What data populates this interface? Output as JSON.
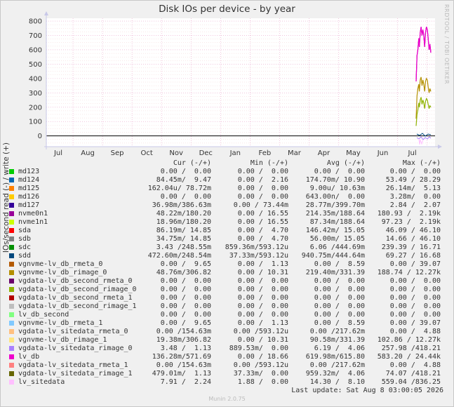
{
  "chart_data": {
    "type": "line",
    "title": "Disk IOs per device - by year",
    "ylabel": "IOs/second read (-) / write (+)",
    "ylim": [
      -75,
      820
    ],
    "yticks": [
      0,
      100,
      200,
      300,
      400,
      500,
      600,
      700,
      800
    ],
    "xticks": [
      "Jul",
      "Aug",
      "Sep",
      "Oct",
      "Nov",
      "Dec",
      "Jan",
      "Feb",
      "Mar",
      "Apr",
      "May",
      "Jun",
      "Jul"
    ],
    "grid": true,
    "series": [
      {
        "name": "md123",
        "color": "#00cc00",
        "cur": "0.00 /  0.00",
        "min": "0.00 /  0.00",
        "avg": "0.00 /  0.00",
        "max": "0.00 /  0.00"
      },
      {
        "name": "md124",
        "color": "#0066b3",
        "cur": "84.45m/  9.47",
        "min": "0.00 /  2.16",
        "avg": "174.70m/ 10.90",
        "max": "53.49 / 28.29"
      },
      {
        "name": "md125",
        "color": "#ff8000",
        "cur": "162.04u/ 78.72m",
        "min": "0.00 /  0.00",
        "avg": "9.00u/ 10.63m",
        "max": "26.14m/  5.13"
      },
      {
        "name": "md126",
        "color": "#ffcc00",
        "cur": "0.00 /  0.00",
        "min": "0.00 /  0.00",
        "avg": "643.00n/  0.00",
        "max": "3.28m/  0.00"
      },
      {
        "name": "md127",
        "color": "#330099",
        "cur": "36.98m/386.63m",
        "min": "0.00 / 73.44m",
        "avg": "28.77m/399.70m",
        "max": "2.84 /  2.07"
      },
      {
        "name": "nvme0n1",
        "color": "#990099",
        "cur": "48.22m/180.20",
        "min": "0.00 / 16.55",
        "avg": "214.35m/188.64",
        "max": "180.93 /  2.19k",
        "line": [
          [
            0,
            380
          ],
          [
            0.06,
            560
          ],
          [
            0.12,
            600
          ],
          [
            0.18,
            680
          ],
          [
            0.22,
            620
          ],
          [
            0.28,
            720
          ],
          [
            0.34,
            760
          ],
          [
            0.4,
            700
          ],
          [
            0.46,
            740
          ],
          [
            0.52,
            700
          ],
          [
            0.58,
            620
          ],
          [
            0.64,
            720
          ],
          [
            0.7,
            760
          ],
          [
            0.76,
            740
          ],
          [
            0.82,
            680
          ],
          [
            0.88,
            600
          ],
          [
            0.94,
            640
          ],
          [
            1.0,
            580
          ]
        ]
      },
      {
        "name": "nvme1n1",
        "color": "#ccff00",
        "cur": "18.96m/180.20",
        "min": "0.00 / 16.55",
        "avg": "87.34m/188.64",
        "max": "97.23 /  2.19k"
      },
      {
        "name": "sda",
        "color": "#ff0000",
        "cur": "86.19m/ 14.85",
        "min": "0.00 /  4.70",
        "avg": "146.42m/ 15.05",
        "max": "46.09 / 46.10"
      },
      {
        "name": "sdb",
        "color": "#808080",
        "cur": "34.75m/ 14.85",
        "min": "0.00 /  4.70",
        "avg": "56.00m/ 15.05",
        "max": "14.66 / 46.10"
      },
      {
        "name": "sdc",
        "color": "#008f00",
        "cur": "3.43 /248.55m",
        "min": "859.36m/593.12u",
        "avg": "6.06 /444.69m",
        "max": "239.39 / 16.71"
      },
      {
        "name": "sdd",
        "color": "#00487d",
        "cur": "472.60m/248.54m",
        "min": "37.33m/593.12u",
        "avg": "940.75m/444.64m",
        "max": "69.27 / 16.68"
      },
      {
        "name": "vgnvme-lv_db_rmeta_0",
        "color": "#b35a00",
        "cur": "0.00 /  9.65",
        "min": "0.00 /  1.13",
        "avg": "0.00 /  8.59",
        "max": "0.00 / 39.07"
      },
      {
        "name": "vgnvme-lv_db_rimage_0",
        "color": "#b38f00",
        "cur": "48.76m/306.82",
        "min": "0.00 / 10.31",
        "avg": "219.40m/331.39",
        "max": "188.74 / 12.27k",
        "line": [
          [
            0,
            120
          ],
          [
            0.06,
            280
          ],
          [
            0.12,
            330
          ],
          [
            0.18,
            360
          ],
          [
            0.22,
            310
          ],
          [
            0.28,
            390
          ],
          [
            0.34,
            410
          ],
          [
            0.4,
            350
          ],
          [
            0.46,
            390
          ],
          [
            0.52,
            360
          ],
          [
            0.58,
            310
          ],
          [
            0.64,
            380
          ],
          [
            0.7,
            400
          ],
          [
            0.76,
            390
          ],
          [
            0.82,
            340
          ],
          [
            0.88,
            300
          ],
          [
            0.94,
            330
          ],
          [
            1.0,
            310
          ]
        ]
      },
      {
        "name": "vgdata-lv_db_second_rmeta_0",
        "color": "#6b006b",
        "cur": "0.00 /  0.00",
        "min": "0.00 /  0.00",
        "avg": "0.00 /  0.00",
        "max": "0.00 /  0.00"
      },
      {
        "name": "vgdata-lv_db_second_rimage_0",
        "color": "#8fb300",
        "cur": "0.00 /  0.00",
        "min": "0.00 /  0.00",
        "avg": "0.00 /  0.00",
        "max": "0.00 /  0.00",
        "line": [
          [
            0,
            70
          ],
          [
            0.06,
            150
          ],
          [
            0.12,
            180
          ],
          [
            0.18,
            230
          ],
          [
            0.22,
            200
          ],
          [
            0.28,
            250
          ],
          [
            0.34,
            270
          ],
          [
            0.4,
            220
          ],
          [
            0.46,
            250
          ],
          [
            0.52,
            230
          ],
          [
            0.58,
            190
          ],
          [
            0.64,
            240
          ],
          [
            0.7,
            260
          ],
          [
            0.76,
            250
          ],
          [
            0.82,
            220
          ],
          [
            0.88,
            190
          ],
          [
            0.94,
            210
          ],
          [
            1.0,
            200
          ]
        ]
      },
      {
        "name": "vgdata-lv_db_second_rmeta_1",
        "color": "#b30000",
        "cur": "0.00 /  0.00",
        "min": "0.00 /  0.00",
        "avg": "0.00 /  0.00",
        "max": "0.00 /  0.00"
      },
      {
        "name": "vgdata-lv_db_second_rimage_1",
        "color": "#bebebe",
        "cur": "0.00 /  0.00",
        "min": "0.00 /  0.00",
        "avg": "0.00 /  0.00",
        "max": "0.00 /  0.00"
      },
      {
        "name": "lv_db_second",
        "color": "#80ff80",
        "cur": "0.00 /  0.00",
        "min": "0.00 /  0.00",
        "avg": "0.00 /  0.00",
        "max": "0.00 /  0.00"
      },
      {
        "name": "vgnvme-lv_db_rmeta_1",
        "color": "#80c9ff",
        "cur": "0.00 /  9.65",
        "min": "0.00 /  1.13",
        "avg": "0.00 /  8.59",
        "max": "0.00 / 39.07"
      },
      {
        "name": "vgdata-lv_sitedata_rmeta_0",
        "color": "#ffc080",
        "cur": "0.00 /154.63m",
        "min": "0.00 /593.12u",
        "avg": "0.00 /217.62m",
        "max": "0.00 /  4.88"
      },
      {
        "name": "vgnvme-lv_db_rimage_1",
        "color": "#ffe680",
        "cur": "19.38m/306.82",
        "min": "0.00 / 10.31",
        "avg": "90.58m/331.39",
        "max": "102.86 / 12.27k"
      },
      {
        "name": "vgdata-lv_sitedata_rimage_0",
        "color": "#aa80ff",
        "cur": "3.48 /  1.13",
        "min": "889.53m/  0.00",
        "avg": "6.19 /  4.06",
        "max": "257.98 /418.21"
      },
      {
        "name": "lv_db",
        "color": "#ee00cc",
        "cur": "136.28m/571.69",
        "min": "0.00 / 18.66",
        "avg": "619.98m/615.80",
        "max": "583.20 / 24.44k",
        "line": [
          [
            0,
            380
          ],
          [
            0.06,
            560
          ],
          [
            0.12,
            600
          ],
          [
            0.18,
            680
          ],
          [
            0.22,
            620
          ],
          [
            0.28,
            720
          ],
          [
            0.34,
            760
          ],
          [
            0.4,
            700
          ],
          [
            0.46,
            740
          ],
          [
            0.52,
            700
          ],
          [
            0.58,
            620
          ],
          [
            0.64,
            720
          ],
          [
            0.7,
            760
          ],
          [
            0.76,
            740
          ],
          [
            0.82,
            680
          ],
          [
            0.88,
            600
          ],
          [
            0.94,
            640
          ],
          [
            1.0,
            580
          ]
        ]
      },
      {
        "name": "vgdata-lv_sitedata_rmeta_1",
        "color": "#ff8080",
        "cur": "0.00 /154.63m",
        "min": "0.00 /593.12u",
        "avg": "0.00 /217.62m",
        "max": "0.00 /  4.88"
      },
      {
        "name": "vgdata-lv_sitedata_rimage_1",
        "color": "#666600",
        "cur": "479.01m/  1.13",
        "min": "37.33m/  0.00",
        "avg": "959.32m/  4.06",
        "max": "74.07 /418.21"
      },
      {
        "name": "lv_sitedata",
        "color": "#ffbfff",
        "cur": "7.91 /  2.24",
        "min": "1.88 /  0.00",
        "avg": "14.30 /  8.10",
        "max": "559.04 /836.25"
      }
    ]
  },
  "legend_headers": {
    "cur": "Cur (-/+)",
    "min": "Min (-/+)",
    "avg": "Avg (-/+)",
    "max": "Max (-/+)"
  },
  "side_credit": "RRDTOOL / TOBI OETIKER",
  "last_update": "Last update:  Sat Aug  8 03:00:05 2026",
  "footer": "Munin 2.0.75"
}
